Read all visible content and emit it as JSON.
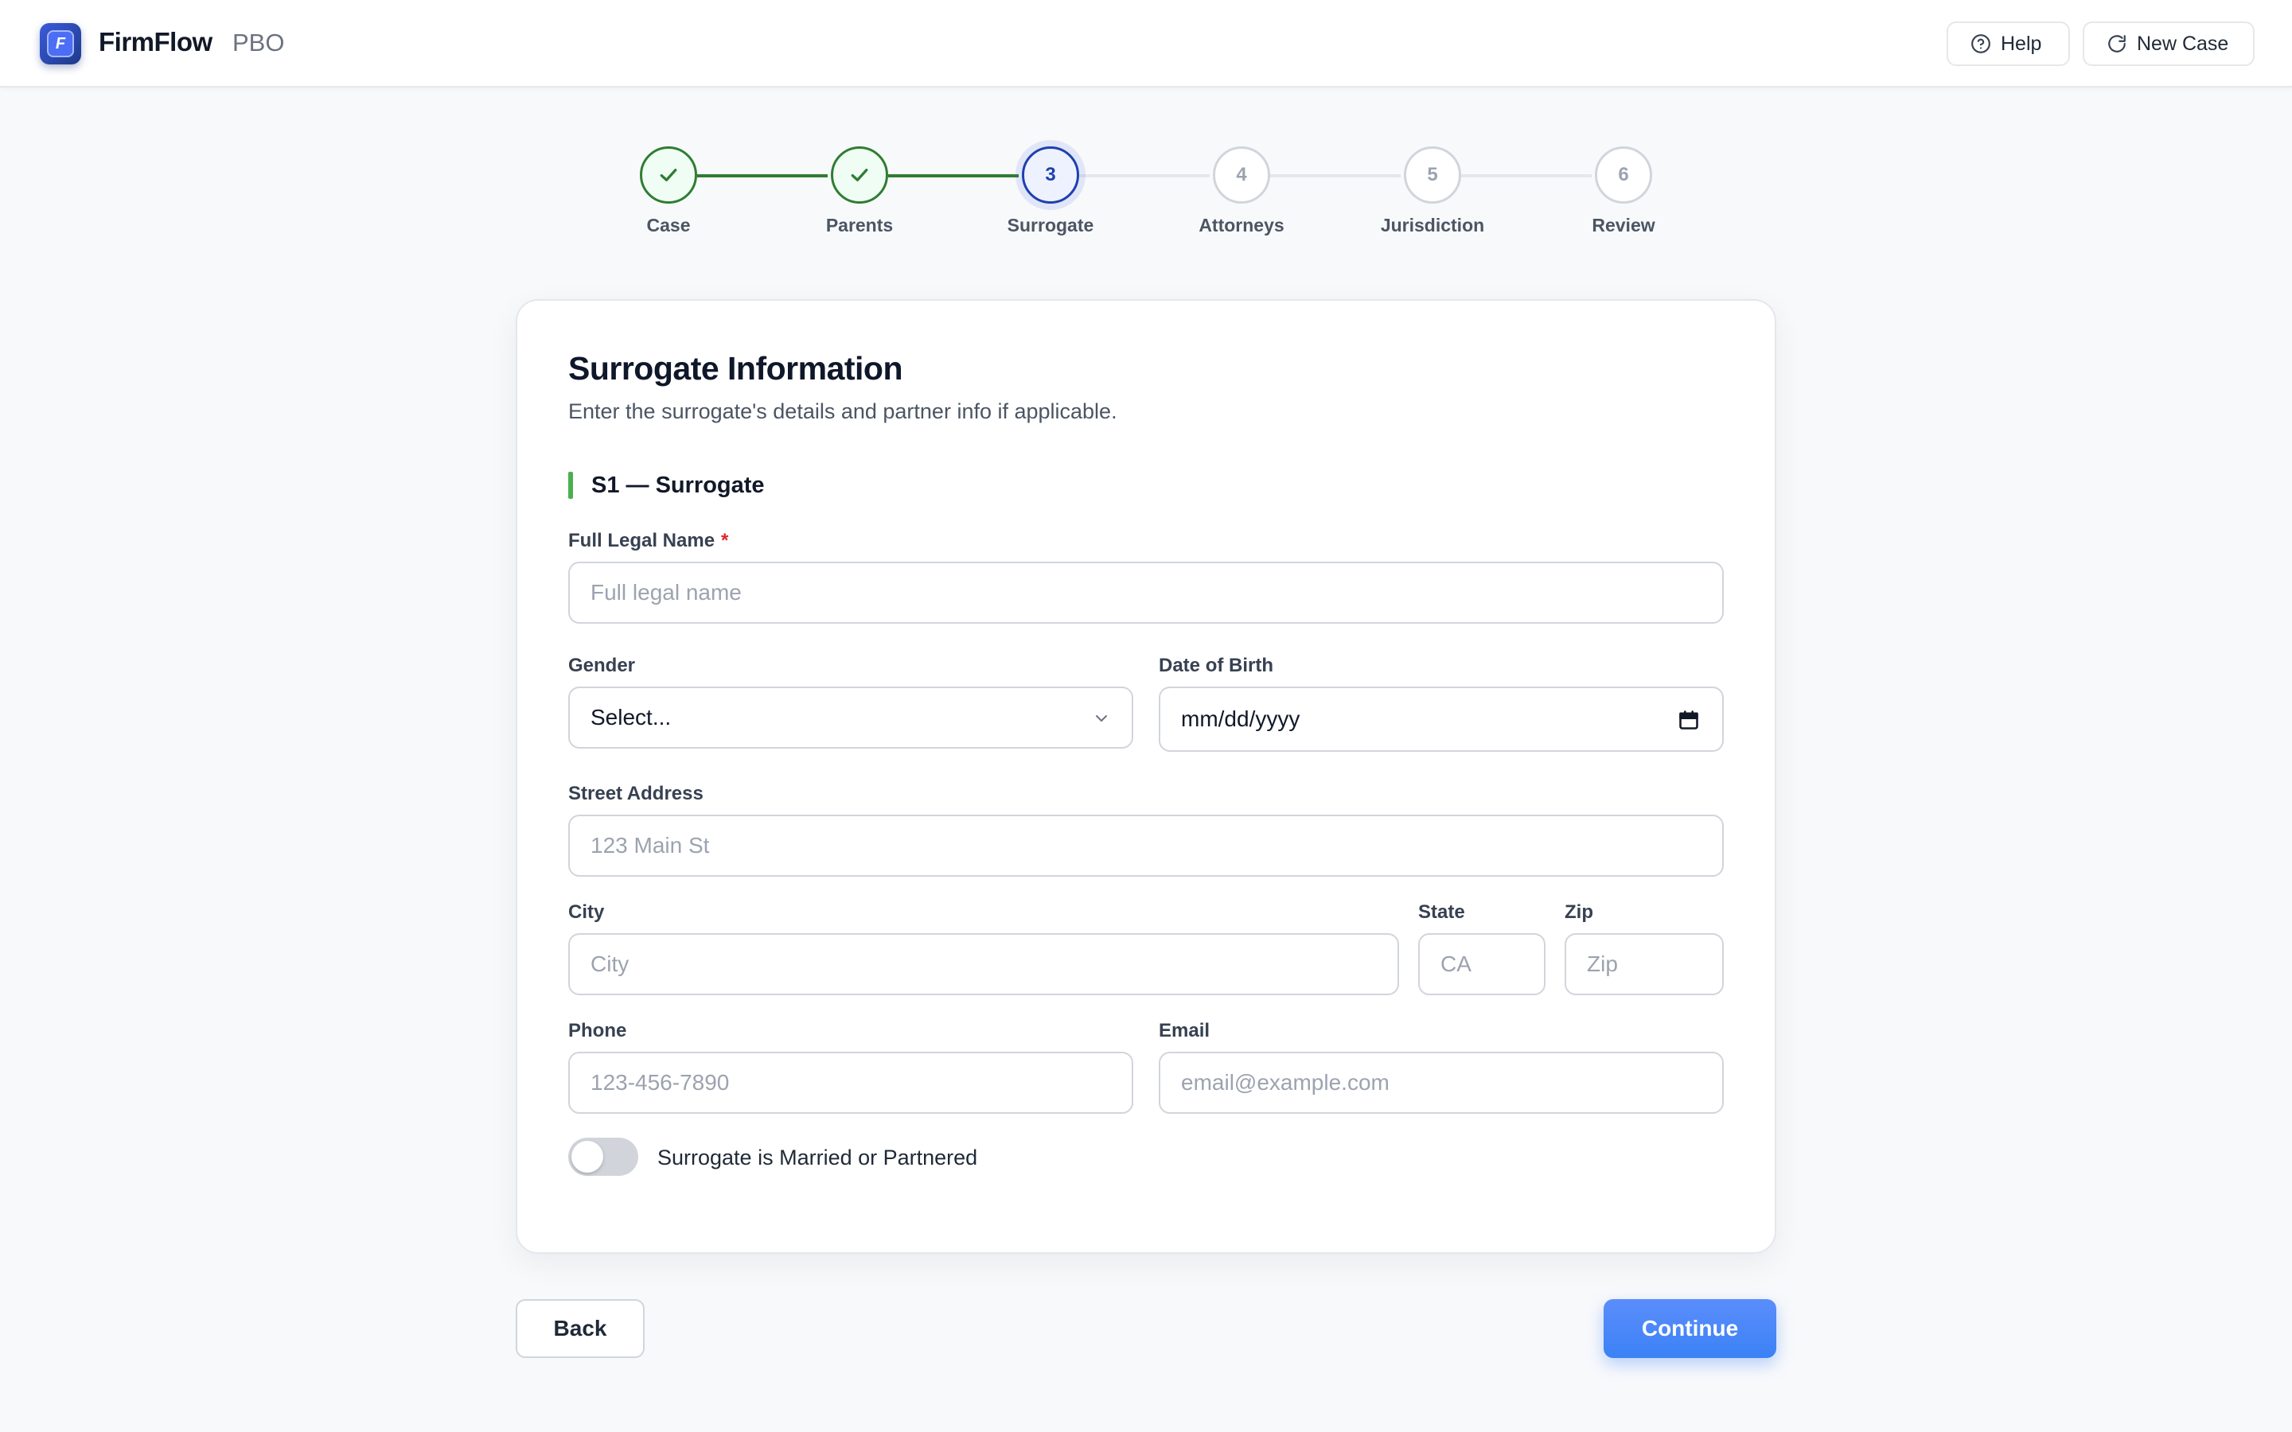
{
  "header": {
    "brand": "FirmFlow",
    "brand_sub": "PBO",
    "logo_letter": "F",
    "help_label": "Help",
    "new_case_label": "New Case"
  },
  "stepper": {
    "steps": [
      {
        "number": "1",
        "label": "Case",
        "state": "done"
      },
      {
        "number": "2",
        "label": "Parents",
        "state": "done"
      },
      {
        "number": "3",
        "label": "Surrogate",
        "state": "active"
      },
      {
        "number": "4",
        "label": "Attorneys",
        "state": "pending"
      },
      {
        "number": "5",
        "label": "Jurisdiction",
        "state": "pending"
      },
      {
        "number": "6",
        "label": "Review",
        "state": "pending"
      }
    ]
  },
  "form": {
    "title": "Surrogate Information",
    "subtitle": "Enter the surrogate's details and partner info if applicable.",
    "section_title": "S1 — Surrogate",
    "full_name": {
      "label": "Full Legal Name",
      "required_mark": "*",
      "placeholder": "Full legal name",
      "value": ""
    },
    "gender": {
      "label": "Gender",
      "value": "Select..."
    },
    "dob": {
      "label": "Date of Birth",
      "value": "mm/dd/yyyy"
    },
    "street": {
      "label": "Street Address",
      "placeholder": "123 Main St",
      "value": ""
    },
    "city": {
      "label": "City",
      "placeholder": "City",
      "value": ""
    },
    "state": {
      "label": "State",
      "placeholder": "CA",
      "value": ""
    },
    "zip": {
      "label": "Zip",
      "placeholder": "Zip",
      "value": ""
    },
    "phone": {
      "label": "Phone",
      "placeholder": "123-456-7890",
      "value": ""
    },
    "email": {
      "label": "Email",
      "placeholder": "email@example.com",
      "value": ""
    },
    "married_toggle": {
      "label": "Surrogate is Married or Partnered",
      "on": false
    }
  },
  "footer": {
    "back_label": "Back",
    "continue_label": "Continue"
  },
  "colors": {
    "accent": "#3b82f6",
    "done_green": "#2f7d32",
    "active_blue": "#1e40af",
    "section_bar": "#4caf50"
  },
  "icons": [
    "logo-icon",
    "help-circle-icon",
    "refresh-icon",
    "check-icon",
    "chevron-down-icon",
    "calendar-icon"
  ]
}
